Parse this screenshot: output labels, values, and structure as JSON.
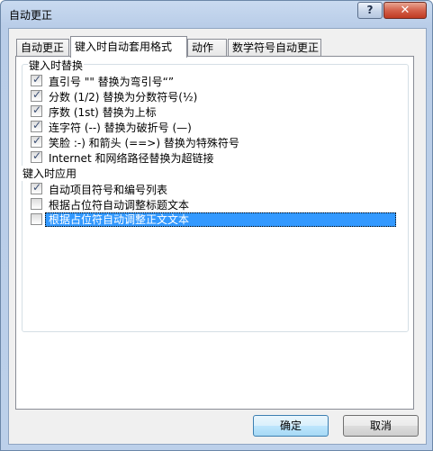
{
  "window": {
    "title": "自动更正",
    "help_label": "?",
    "close_label": "✕"
  },
  "tabs": [
    {
      "label": "自动更正"
    },
    {
      "label": "键入时自动套用格式"
    },
    {
      "label": "动作"
    },
    {
      "label": "数学符号自动更正"
    }
  ],
  "groups": {
    "replace_as_you_type": {
      "label": "键入时替换",
      "options": [
        {
          "label": "直引号 \"\" 替换为弯引号“”",
          "checked": true
        },
        {
          "label": "分数 (1/2) 替换为分数符号(½)",
          "checked": true
        },
        {
          "label": "序数 (1st) 替换为上标",
          "checked": true
        },
        {
          "label": "连字符 (--) 替换为破折号 (—)",
          "checked": true
        },
        {
          "label": "笑脸 :-) 和箭头 (==>) 替换为特殊符号",
          "checked": true
        },
        {
          "label": "Internet 和网络路径替换为超链接",
          "checked": true
        }
      ]
    },
    "apply_as_you_type": {
      "label": "键入时应用",
      "options": [
        {
          "label": "自动项目符号和编号列表",
          "checked": true
        },
        {
          "label": "根据占位符自动调整标题文本",
          "checked": false
        },
        {
          "label": "根据占位符自动调整正文文本",
          "checked": false,
          "selected": true
        }
      ]
    }
  },
  "buttons": {
    "ok": "确定",
    "cancel": "取消"
  }
}
